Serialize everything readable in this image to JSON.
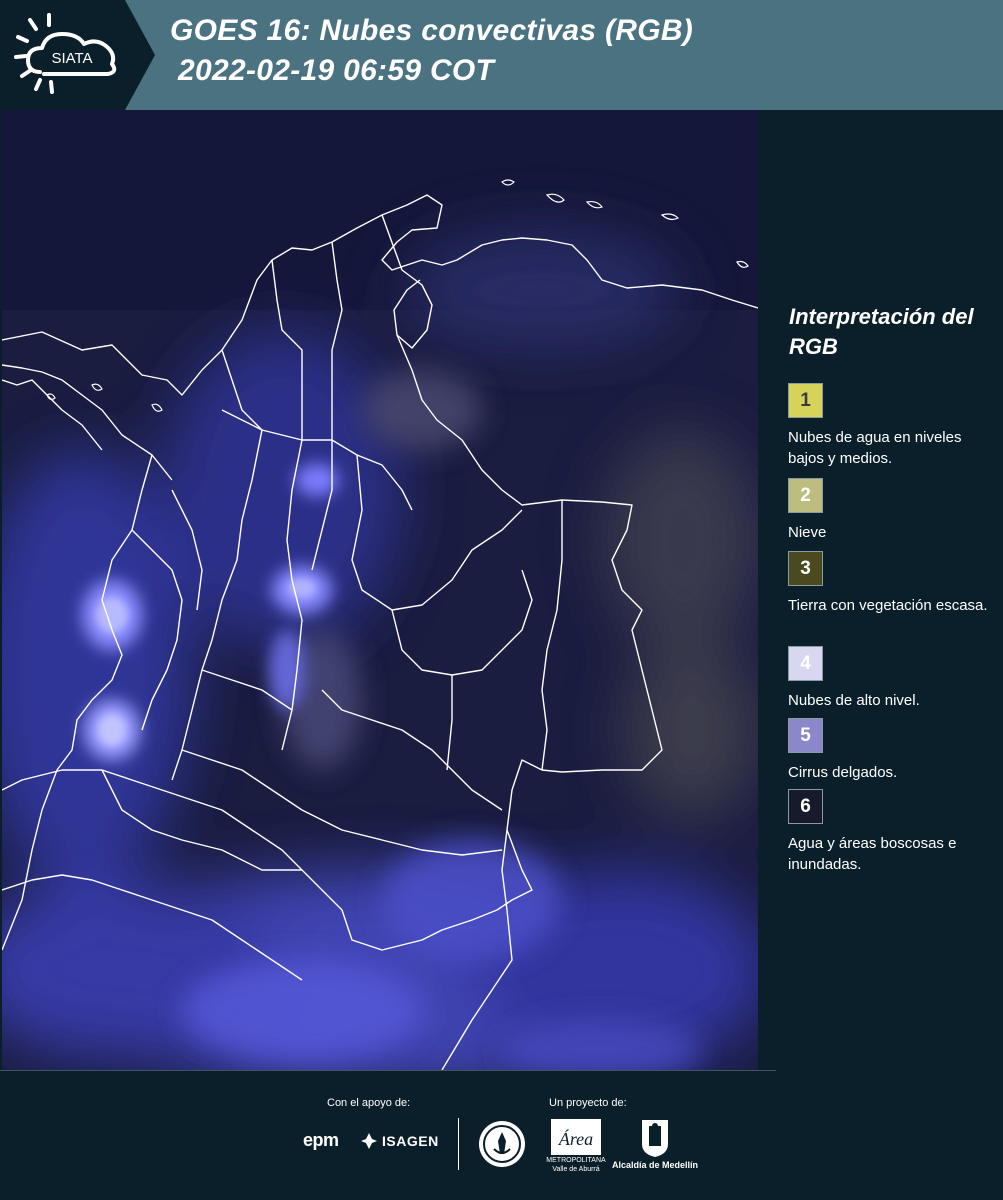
{
  "header": {
    "logo_text": "SIATA",
    "title_line1": "GOES 16: Nubes convectivas (RGB)",
    "title_line2": "2022-02-19 06:59 COT"
  },
  "legend": {
    "title": "Interpretación del RGB",
    "items": [
      {
        "number": "1",
        "color": "#d6d25a",
        "text_color": "#3b3b3b",
        "label": "Nubes de agua en niveles bajos y medios."
      },
      {
        "number": "2",
        "color": "#bdbd80",
        "text_color": "#ffffff",
        "label": "Nieve"
      },
      {
        "number": "3",
        "color": "#4a4a1e",
        "text_color": "#ffffff",
        "label": "Tierra con vegetación escasa."
      },
      {
        "number": "4",
        "color": "#d8d6f0",
        "text_color": "#ffffff",
        "label": "Nubes de alto nivel."
      },
      {
        "number": "5",
        "color": "#8a88c8",
        "text_color": "#ffffff",
        "label": "Cirrus delgados."
      },
      {
        "number": "6",
        "color": "#161a2a",
        "text_color": "#ffffff",
        "label": "Agua y áreas boscosas e inundadas."
      }
    ]
  },
  "footer": {
    "support_label": "Con el apoyo de:",
    "project_label": "Un proyecto de:",
    "sponsor_1": "epm",
    "sponsor_2": "ISAGEN",
    "partner_area": "METROPOLITANA Valle de Aburrá",
    "partner_alcaldia": "Alcaldía de Medellín",
    "partner_area_logo_text": "Área"
  },
  "colors": {
    "header_bg": "#4a7281",
    "logo_panel_bg": "#0b1f2a",
    "page_bg": "#0b1f2a",
    "map_base": "#1a1d44",
    "cloud_blue": "#5a5cf0",
    "border_white": "#ffffff"
  }
}
